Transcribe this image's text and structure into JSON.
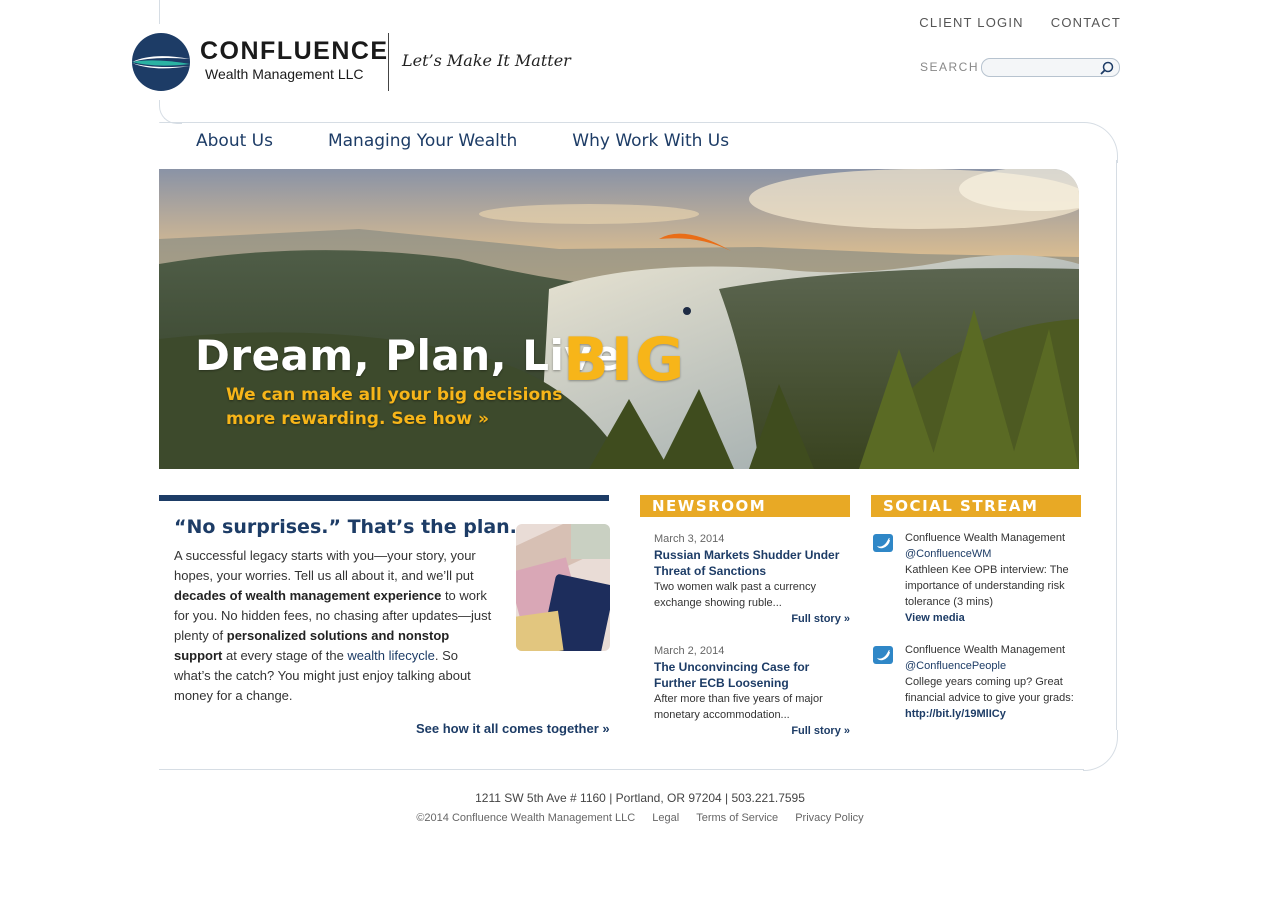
{
  "header": {
    "brand_name": "CONFLUENCE",
    "brand_sub": "Wealth Management LLC",
    "tagline": "Let’s Make It Matter",
    "top_links": [
      "CLIENT LOGIN",
      "CONTACT"
    ],
    "search_label": "SEARCH",
    "search_placeholder": ""
  },
  "nav": {
    "items": [
      "About Us",
      "Managing Your Wealth",
      "Why Work With Us"
    ]
  },
  "hero": {
    "title": "Dream, Plan, Live",
    "title_accent": "BIG",
    "sub_line1": "We can make all your big decisions",
    "sub_line2": "more rewarding. See how »"
  },
  "intro": {
    "title": "“No surprises.” That’s the plan.",
    "p1": "A successful legacy starts with you—your story, your hopes, your worries. Tell us all about it, and we’ll put ",
    "b1": "decades of wealth management experience",
    "p2": " to work for you. No hidden fees, no chasing after updates—just plenty of ",
    "b2": "personalized solutions and nonstop support",
    "p3": " at every stage of the ",
    "link": "wealth lifecycle",
    "p4": ". So what’s the catch? You might just enjoy talking about money for a change.",
    "cta": "See how it all comes together »"
  },
  "newsroom": {
    "heading": "NEWSROOM",
    "items": [
      {
        "date": "March 3, 2014",
        "title": "Russian Markets Shudder Under Threat of Sanctions",
        "summary": "Two women walk past a currency exchange showing ruble...",
        "more": "Full story »"
      },
      {
        "date": "March 2, 2014",
        "title": "The Unconvincing Case for Further ECB Loosening",
        "summary": "After more than five years of major monetary accommodation...",
        "more": "Full story »"
      }
    ]
  },
  "social": {
    "heading": "SOCIAL STREAM",
    "items": [
      {
        "account": "Confluence Wealth Management",
        "handle": "@ConfluenceWM",
        "text": "Kathleen Kee OPB interview: The importance of understanding risk tolerance (3 mins)",
        "link": "View media"
      },
      {
        "account": "Confluence Wealth Management",
        "handle": "@ConfluencePeople",
        "text": "College years coming up? Great financial advice to give your grads:",
        "link": "http://bit.ly/19MlICy"
      }
    ]
  },
  "footer": {
    "address": "1211 SW 5th Ave # 1160 | Portland, OR 97204 | 503.221.7595",
    "copyright": "©2014 Confluence Wealth Management LLC",
    "links": [
      "Legal",
      "Terms of Service",
      "Privacy Policy"
    ]
  },
  "colors": {
    "navy": "#1d3c66",
    "gold": "#e8a925",
    "hero_accent": "#f7b519",
    "logo_teal": "#2bb3a3"
  }
}
